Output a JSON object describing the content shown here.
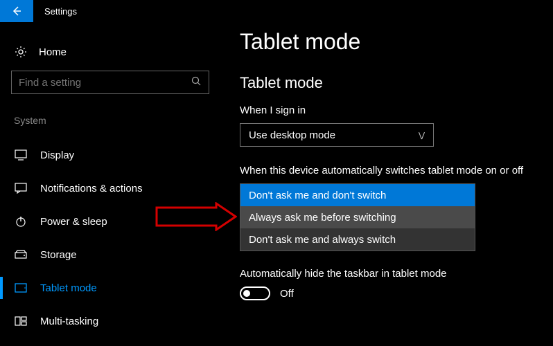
{
  "titlebar": {
    "label": "Settings"
  },
  "sidebar": {
    "home": "Home",
    "search_placeholder": "Find a setting",
    "group": "System",
    "items": [
      {
        "label": "Display"
      },
      {
        "label": "Notifications & actions"
      },
      {
        "label": "Power & sleep"
      },
      {
        "label": "Storage"
      },
      {
        "label": "Tablet mode"
      },
      {
        "label": "Multi-tasking"
      }
    ]
  },
  "main": {
    "title": "Tablet mode",
    "section": "Tablet mode",
    "signin_label": "When I sign in",
    "signin_value": "Use desktop mode",
    "switch_label": "When this device automatically switches tablet mode on or off",
    "switch_options": [
      "Don't ask me and don't switch",
      "Always ask me before switching",
      "Don't ask me and always switch"
    ],
    "hide_taskbar_label": "Automatically hide the taskbar in tablet mode",
    "toggle_state": "Off"
  }
}
